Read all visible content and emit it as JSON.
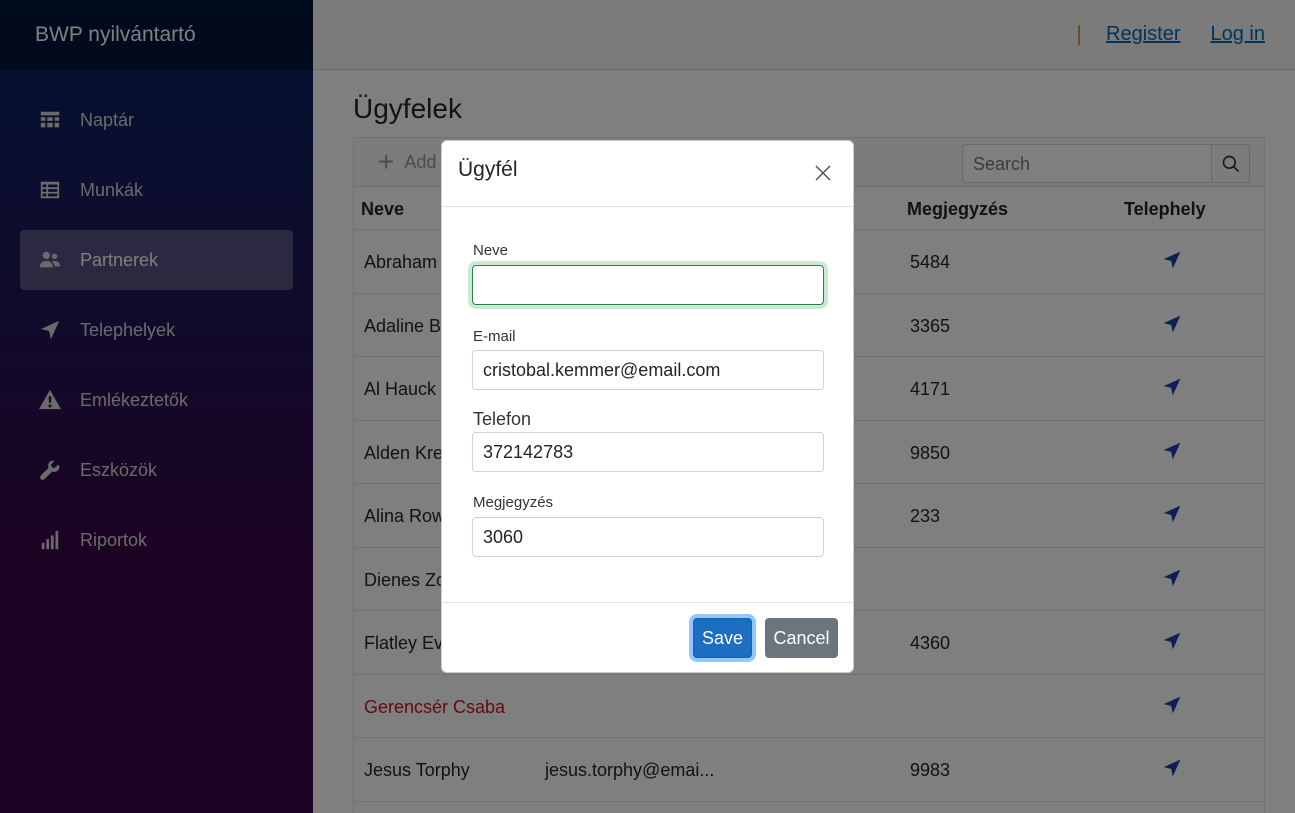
{
  "app": {
    "brand": "BWP nyilvántartó"
  },
  "sidebar": {
    "items": [
      {
        "label": "Naptár",
        "icon": "calendar-icon",
        "active": false
      },
      {
        "label": "Munkák",
        "icon": "list-icon",
        "active": false
      },
      {
        "label": "Partnerek",
        "icon": "people-icon",
        "active": true
      },
      {
        "label": "Telephelyek",
        "icon": "location-arrow-icon",
        "active": false
      },
      {
        "label": "Emlékeztetők",
        "icon": "warning-icon",
        "active": false
      },
      {
        "label": "Eszközök",
        "icon": "wrench-icon",
        "active": false
      },
      {
        "label": "Riportok",
        "icon": "bar-chart-icon",
        "active": false
      }
    ]
  },
  "top": {
    "register": "Register",
    "login": "Log in"
  },
  "page": {
    "title": "Ügyfelek"
  },
  "grid": {
    "add_label": "Add",
    "search_placeholder": "Search",
    "columns": [
      "Neve",
      "Megjegyzés",
      "Telephely"
    ],
    "rows": [
      {
        "name": "Abraham",
        "email": "",
        "note": "5484"
      },
      {
        "name": "Adaline Ba",
        "email": "",
        "note": "3365"
      },
      {
        "name": "Al Hauck",
        "email": "",
        "note": "4171"
      },
      {
        "name": "Alden Krei",
        "email": "",
        "note": "9850"
      },
      {
        "name": "Alina Row",
        "email": "",
        "note": "233"
      },
      {
        "name": "Dienes Zo",
        "email": "",
        "note": ""
      },
      {
        "name": "Flatley Eva",
        "email": "",
        "note": "4360"
      },
      {
        "name": "Gerencsér Csaba",
        "email": "",
        "note": ""
      },
      {
        "name": "Jesus Torphy",
        "email": "jesus.torphy@emai...",
        "note": "9983"
      }
    ]
  },
  "modal": {
    "title": "Ügyfél",
    "fields": {
      "name_label": "Neve",
      "name_value": "",
      "email_label": "E-mail",
      "email_value": "cristobal.kemmer@email.com",
      "phone_label": "Telefon",
      "phone_value": "372142783",
      "note_label": "Megjegyzés",
      "note_value": "3060"
    },
    "save": "Save",
    "cancel": "Cancel"
  },
  "colors": {
    "accent": "#1b6ec2",
    "link": "#006bb7",
    "danger_text": "#c7161d"
  }
}
